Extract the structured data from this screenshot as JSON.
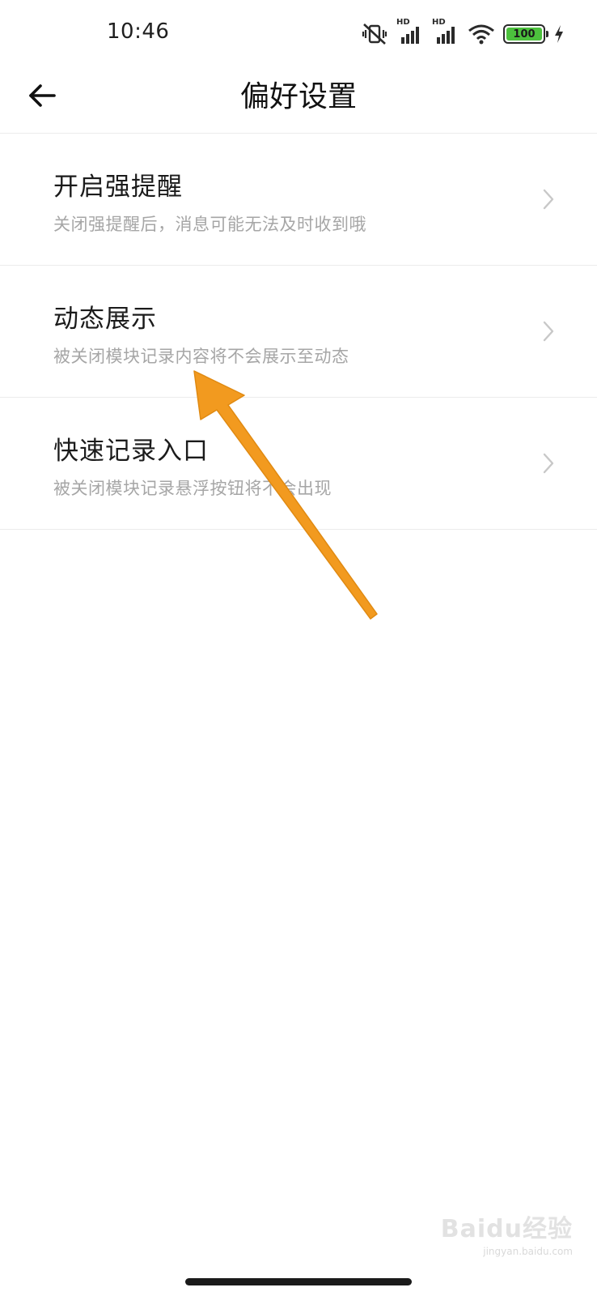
{
  "status_bar": {
    "time": "10:46",
    "signal_1_label": "HD",
    "signal_2_label": "HD",
    "battery_level": "100",
    "icons": [
      "mute-vibrate-icon",
      "signal-hd-icon",
      "signal-hd-icon",
      "wifi-icon",
      "battery-icon",
      "charging-bolt-icon"
    ]
  },
  "header": {
    "back_icon": "arrow-left-icon",
    "title": "偏好设置"
  },
  "settings": {
    "items": [
      {
        "title": "开启强提醒",
        "description": "关闭强提醒后，消息可能无法及时收到哦"
      },
      {
        "title": "动态展示",
        "description": "被关闭模块记录内容将不会展示至动态"
      },
      {
        "title": "快速记录入口",
        "description": "被关闭模块记录悬浮按钮将不会出现"
      }
    ],
    "chevron_icon": "chevron-right-icon"
  },
  "annotation": {
    "arrow_color": "#f29a1f"
  },
  "watermark": {
    "main": "Baidu经验",
    "sub": "jingyan.baidu.com"
  },
  "colors": {
    "background": "#ffffff",
    "title_text": "#1b1b1b",
    "description_text": "#a6a6a6",
    "divider": "#ececec",
    "battery_fill": "#4cc13d"
  }
}
